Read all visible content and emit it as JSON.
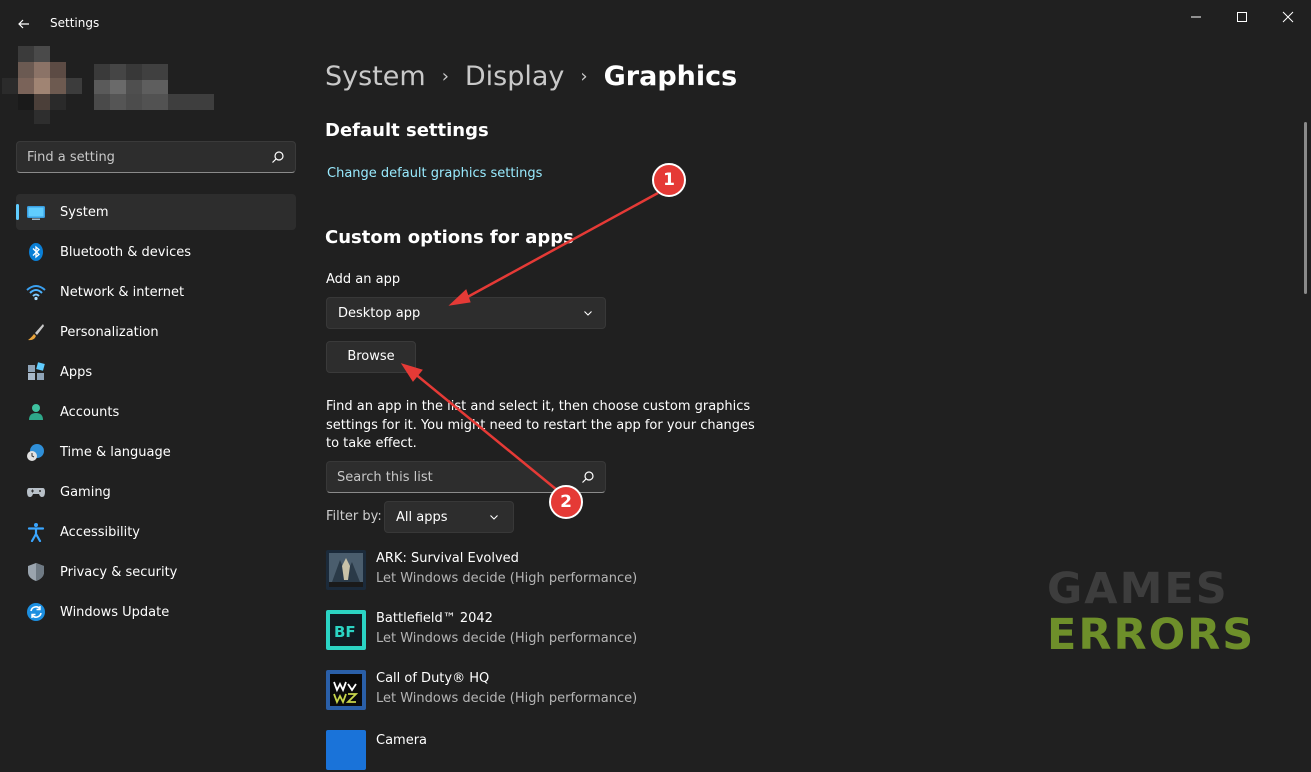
{
  "window": {
    "title": "Settings"
  },
  "sidebar": {
    "search_placeholder": "Find a setting",
    "items": [
      {
        "label": "System",
        "icon": "system-icon",
        "active": true
      },
      {
        "label": "Bluetooth & devices",
        "icon": "bluetooth-icon"
      },
      {
        "label": "Network & internet",
        "icon": "wifi-icon"
      },
      {
        "label": "Personalization",
        "icon": "brush-icon"
      },
      {
        "label": "Apps",
        "icon": "apps-icon"
      },
      {
        "label": "Accounts",
        "icon": "person-icon"
      },
      {
        "label": "Time & language",
        "icon": "clock-globe-icon"
      },
      {
        "label": "Gaming",
        "icon": "gamepad-icon"
      },
      {
        "label": "Accessibility",
        "icon": "accessibility-icon"
      },
      {
        "label": "Privacy & security",
        "icon": "shield-icon"
      },
      {
        "label": "Windows Update",
        "icon": "update-icon"
      }
    ]
  },
  "breadcrumb": {
    "items": [
      "System",
      "Display",
      "Graphics"
    ]
  },
  "main": {
    "default_settings_heading": "Default settings",
    "change_default_link": "Change default graphics settings",
    "custom_options_heading": "Custom options for apps",
    "add_app_label": "Add an app",
    "app_type_selected": "Desktop app",
    "browse_label": "Browse",
    "description": "Find an app in the list and select it, then choose custom graphics settings for it. You might need to restart the app for your changes to take effect.",
    "list_search_placeholder": "Search this list",
    "filter_label": "Filter by:",
    "filter_selected": "All apps",
    "apps": [
      {
        "name": "ARK: Survival Evolved",
        "setting": "Let Windows decide (High performance)",
        "icon": "ark-game-icon"
      },
      {
        "name": "Battlefield™ 2042",
        "setting": "Let Windows decide (High performance)",
        "icon": "battlefield-game-icon"
      },
      {
        "name": "Call of Duty® HQ",
        "setting": "Let Windows decide (High performance)",
        "icon": "call-of-duty-game-icon"
      },
      {
        "name": "Camera",
        "setting": "",
        "icon": "camera-app-icon"
      }
    ]
  },
  "annotations": {
    "badge_1": "1",
    "badge_2": "2",
    "color": "#e53a36"
  },
  "watermark": {
    "line1": "GAMES",
    "line2": "ERRORS"
  },
  "colors": {
    "background": "#202020",
    "accent": "#60cdff",
    "link": "#99ebff"
  }
}
